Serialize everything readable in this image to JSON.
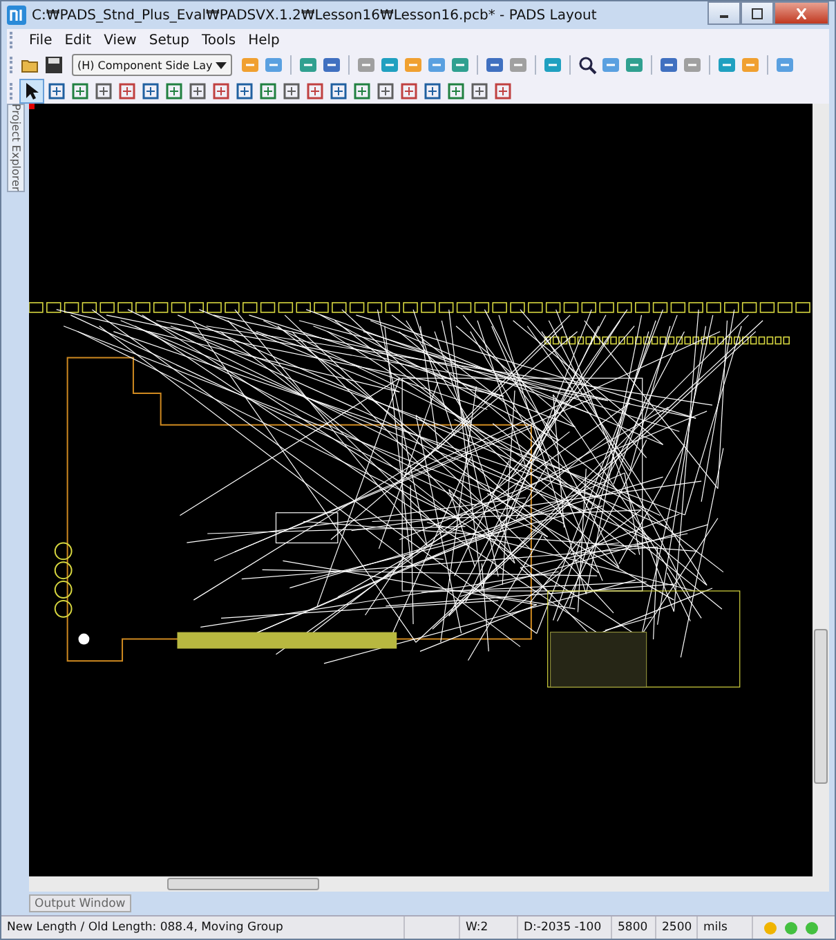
{
  "window": {
    "title": "C:₩PADS_Stnd_Plus_Eval₩PADSVX.1.2₩Lesson16₩Lesson16.pcb* - PADS Layout"
  },
  "menu": [
    "File",
    "Edit",
    "View",
    "Setup",
    "Tools",
    "Help"
  ],
  "layer_dropdown": {
    "value": "(H) Component Side Lay"
  },
  "side_panel": {
    "label": "Project Explorer"
  },
  "output_tab": {
    "label": "Output Window"
  },
  "status_bar": {
    "message": "New Length / Old Length: 088.4, Moving Group",
    "fields": [
      "W:2",
      "D:-2035 -100",
      "5800",
      "2500",
      "mils"
    ],
    "lights": [
      {
        "color": "#f0b400"
      },
      {
        "color": "#44c040"
      },
      {
        "color": "#44c040"
      }
    ]
  }
}
